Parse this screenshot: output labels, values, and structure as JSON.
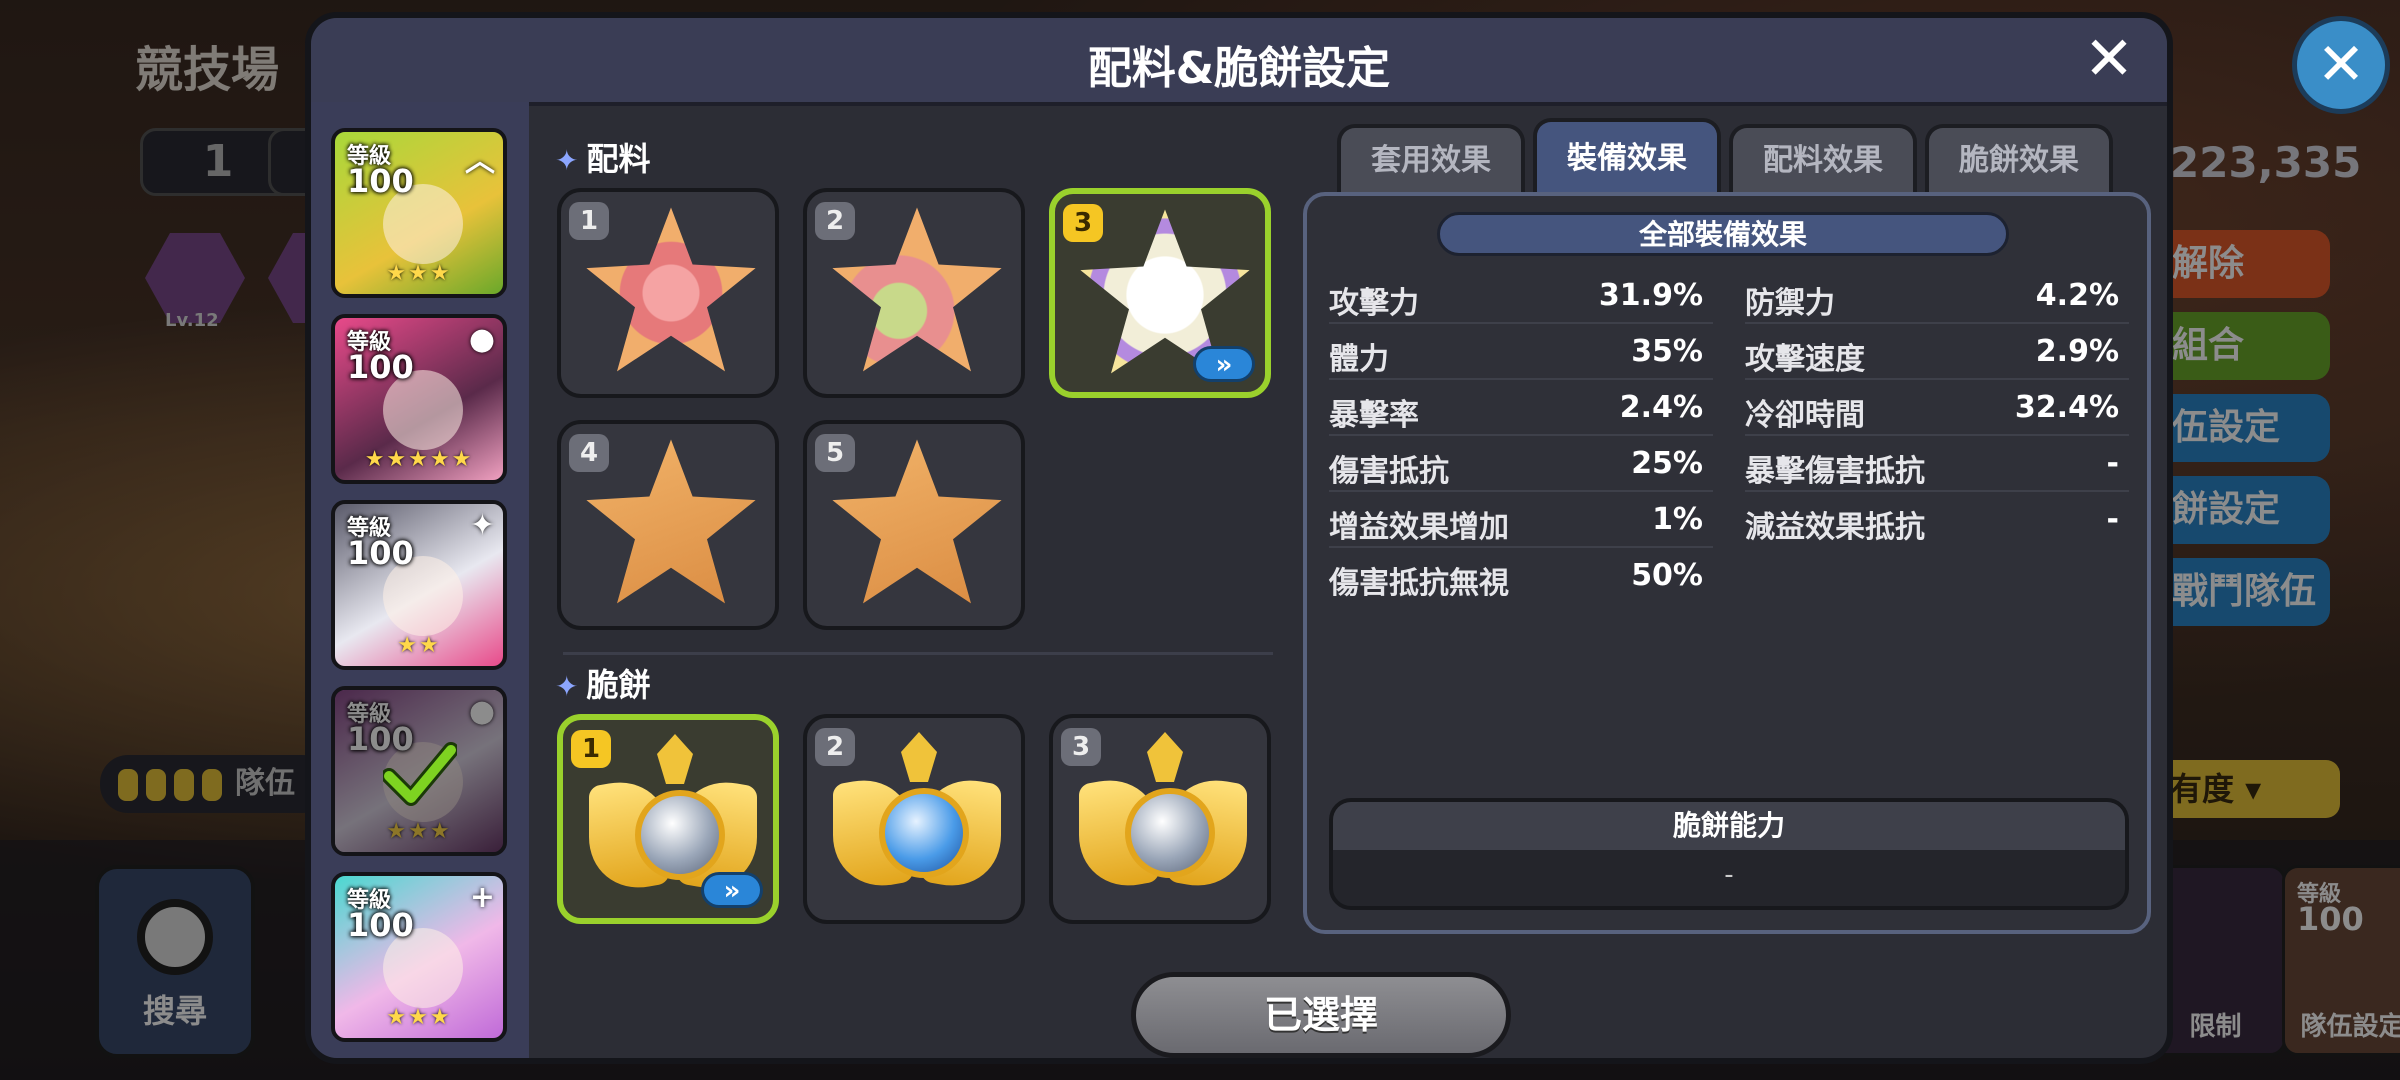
{
  "background": {
    "title": "競技場",
    "team_number": "1",
    "level_badge": "Lv.12",
    "score": "223,335",
    "buttons": [
      "解除",
      "組合",
      "伍設定",
      "餅設定",
      "戰鬥隊伍"
    ],
    "team_label": "隊伍",
    "sort_label": "有度",
    "search_label": "搜尋",
    "limit_label": "限制",
    "team_setting_label": "隊伍設定",
    "card_level_label": "等級",
    "card_level_value": "100"
  },
  "modal": {
    "title": "配料&脆餅設定",
    "close_label": "✕"
  },
  "characters": [
    {
      "level_label": "等級",
      "level": "100",
      "stars": "★★★",
      "corner": "︿"
    },
    {
      "level_label": "等級",
      "level": "100",
      "stars": "★★★★★",
      "corner": "●"
    },
    {
      "level_label": "等級",
      "level": "100",
      "stars": "★★",
      "corner": "✦"
    },
    {
      "level_label": "等級",
      "level": "100",
      "stars": "★★★",
      "corner": "●",
      "selected": true
    },
    {
      "level_label": "等級",
      "level": "100",
      "stars": "★★★",
      "corner": "+"
    }
  ],
  "toppings": {
    "label": "配料",
    "slots": [
      "1",
      "2",
      "3",
      "4",
      "5"
    ],
    "selected_slot": "3"
  },
  "tarts": {
    "label": "脆餅",
    "slots": [
      "1",
      "2",
      "3"
    ],
    "selected_slot": "1"
  },
  "tabs": [
    {
      "label": "套用效果",
      "active": false
    },
    {
      "label": "裝備效果",
      "active": true
    },
    {
      "label": "配料效果",
      "active": false
    },
    {
      "label": "脆餅效果",
      "active": false
    }
  ],
  "stats": {
    "header": "全部裝備效果",
    "left": [
      {
        "name": "攻擊力",
        "value": "31.9%"
      },
      {
        "name": "體力",
        "value": "35%"
      },
      {
        "name": "暴擊率",
        "value": "2.4%"
      },
      {
        "name": "傷害抵抗",
        "value": "25%"
      },
      {
        "name": "增益效果增加",
        "value": "1%"
      },
      {
        "name": "傷害抵抗無視",
        "value": "50%"
      }
    ],
    "right": [
      {
        "name": "防禦力",
        "value": "4.2%"
      },
      {
        "name": "攻擊速度",
        "value": "2.9%"
      },
      {
        "name": "冷卻時間",
        "value": "32.4%"
      },
      {
        "name": "暴擊傷害抵抗",
        "value": "-"
      },
      {
        "name": "減益效果抵抗",
        "value": "-"
      }
    ]
  },
  "cookie_ability": {
    "label": "脆餅能力",
    "value": "-"
  },
  "selected_button": "已選擇",
  "colors": {
    "accent_green": "#9ad12c",
    "slot_number_selected": "#f5c623",
    "tab_active": "#45557e",
    "button_blue": "#2a86d8"
  }
}
